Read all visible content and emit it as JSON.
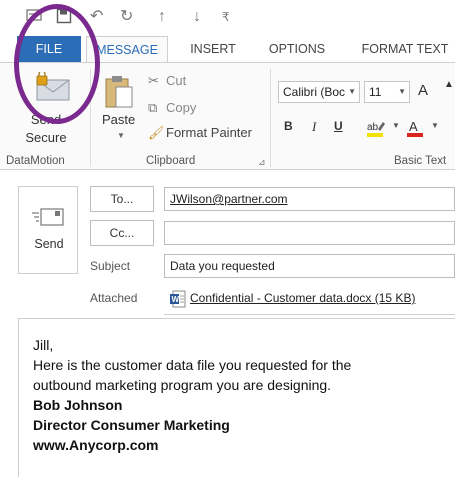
{
  "tabs": {
    "file": "FILE",
    "message": "MESSAGE",
    "insert": "INSERT",
    "options": "OPTIONS",
    "format_text": "FORMAT TEXT"
  },
  "ribbon": {
    "datamotion": {
      "button_label_line1": "Send",
      "button_label_line2": "Secure",
      "group_label": "DataMotion"
    },
    "clipboard": {
      "paste_label": "Paste",
      "cut_label": "Cut",
      "copy_label": "Copy",
      "format_painter_label": "Format Painter",
      "group_label": "Clipboard"
    },
    "basic_text": {
      "font_name": "Calibri (Boc",
      "font_size": "11",
      "bold": "B",
      "italic": "I",
      "underline": "U",
      "grow_font": "A",
      "group_label": "Basic Text"
    }
  },
  "compose": {
    "send_label": "Send",
    "to_button": "To...",
    "cc_button": "Cc...",
    "to_value": "JWilson@partner.com",
    "cc_value": "",
    "subject_label": "Subject",
    "subject_value": "Data you requested",
    "attached_label": "Attached",
    "attachment_name": "Confidential - Customer data.docx (15 KB)"
  },
  "body": {
    "greeting": "Jill,",
    "line1": "Here is the customer data file you requested for the",
    "line2": "outbound marketing program you are designing.",
    "sig_name": "Bob Johnson",
    "sig_title": "Director Consumer Marketing",
    "sig_web": "www.Anycorp.com"
  },
  "colors": {
    "file_tab": "#2b6db6",
    "highlight_oval": "#7a2a8f",
    "font_color_red": "#d9251c",
    "highlight_yellow": "#f5e100"
  }
}
